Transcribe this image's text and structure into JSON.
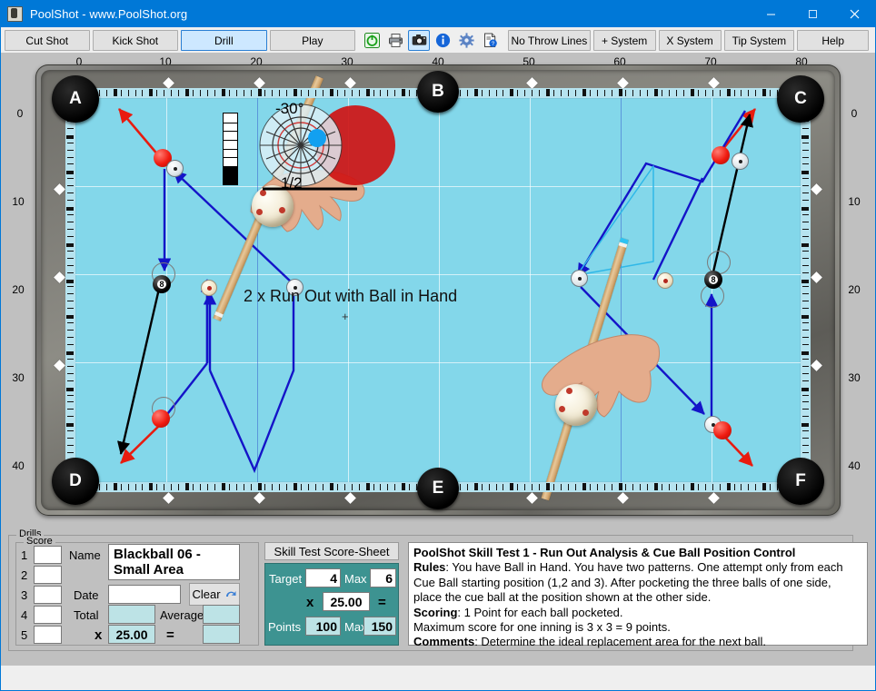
{
  "window": {
    "title": "PoolShot - www.PoolShot.org",
    "minimize": "–",
    "maximize": "□",
    "close": "✕"
  },
  "toolbar": {
    "buttons": [
      {
        "label": "Cut Shot",
        "selected": false
      },
      {
        "label": "Kick Shot",
        "selected": false
      },
      {
        "label": "Drill",
        "selected": true
      },
      {
        "label": "Play",
        "selected": false
      }
    ],
    "icons": [
      {
        "name": "power-icon",
        "selected": false
      },
      {
        "name": "printer-icon",
        "selected": false
      },
      {
        "name": "camera-icon",
        "selected": true
      },
      {
        "name": "info-icon",
        "selected": false
      },
      {
        "name": "gear-icon",
        "selected": false
      },
      {
        "name": "document-help-icon",
        "selected": false
      }
    ],
    "right_buttons": [
      {
        "label": "No Throw Lines"
      },
      {
        "label": "+ System"
      },
      {
        "label": "X System"
      },
      {
        "label": "Tip System"
      },
      {
        "label": "Help"
      }
    ]
  },
  "table": {
    "top_ruler": [
      "0",
      "10",
      "20",
      "30",
      "40",
      "50",
      "60",
      "70",
      "80"
    ],
    "left_ruler": [
      "0",
      "10",
      "20",
      "30",
      "40"
    ],
    "right_ruler": [
      "0",
      "10",
      "20",
      "30",
      "40"
    ],
    "pockets": [
      "A",
      "B",
      "C",
      "D",
      "E",
      "F"
    ],
    "center_label": "2 x Run Out with Ball in Hand",
    "center_cross": "+",
    "aim": {
      "angle": "-30°",
      "fraction": "1/2"
    }
  },
  "drills": {
    "group_label": "Drills",
    "score": {
      "group_label": "Score",
      "rows": [
        "1",
        "2",
        "3",
        "4",
        "5"
      ],
      "values": [
        "",
        "",
        "",
        "",
        ""
      ],
      "name_label": "Name",
      "name_value": "Blackball 06 - Small Area",
      "date_label": "Date",
      "date_value": "",
      "clear_label": "Clear",
      "total_label": "Total",
      "total_value": "",
      "average_label": "Average",
      "average_value": "",
      "multiply_label": "x",
      "multiplier": "25.00",
      "equals_label": "=",
      "result_value": ""
    },
    "skilltest": {
      "title": "Skill Test Score-Sheet",
      "target_label": "Target",
      "target_value": "4",
      "target_max_label": "Max",
      "target_max_value": "6",
      "multiply_label": "x",
      "multiplier": "25.00",
      "equals_label": "=",
      "points_label": "Points",
      "points_value": "100",
      "points_max_label": "Max",
      "points_max_value": "150"
    },
    "description": {
      "heading": "PoolShot Skill Test 1 - Run Out Analysis & Cue Ball Position Control",
      "rules_label": "Rules",
      "rules_text": ": You have Ball in Hand. You have two patterns. One attempt only from each Cue Ball starting position (1,2 and 3). After pocketing the three balls of one side, place the cue ball at the position shown at the other side.",
      "scoring_label": "Scoring",
      "scoring_text": ": 1 Point for each ball pocketed.",
      "max_line": "Maximum score for one inning is 3 x 3 = 9 points.",
      "comments_label": "Comments",
      "comments_text": ": Determine the ideal replacement area for the next ball."
    }
  },
  "colors": {
    "accent": "#0078d7",
    "felt": "#83d7ea",
    "teal_panel": "#3d9391",
    "red_ball": "#f01b10",
    "blue_line": "#1414c8",
    "red_line": "#e81b0f"
  }
}
